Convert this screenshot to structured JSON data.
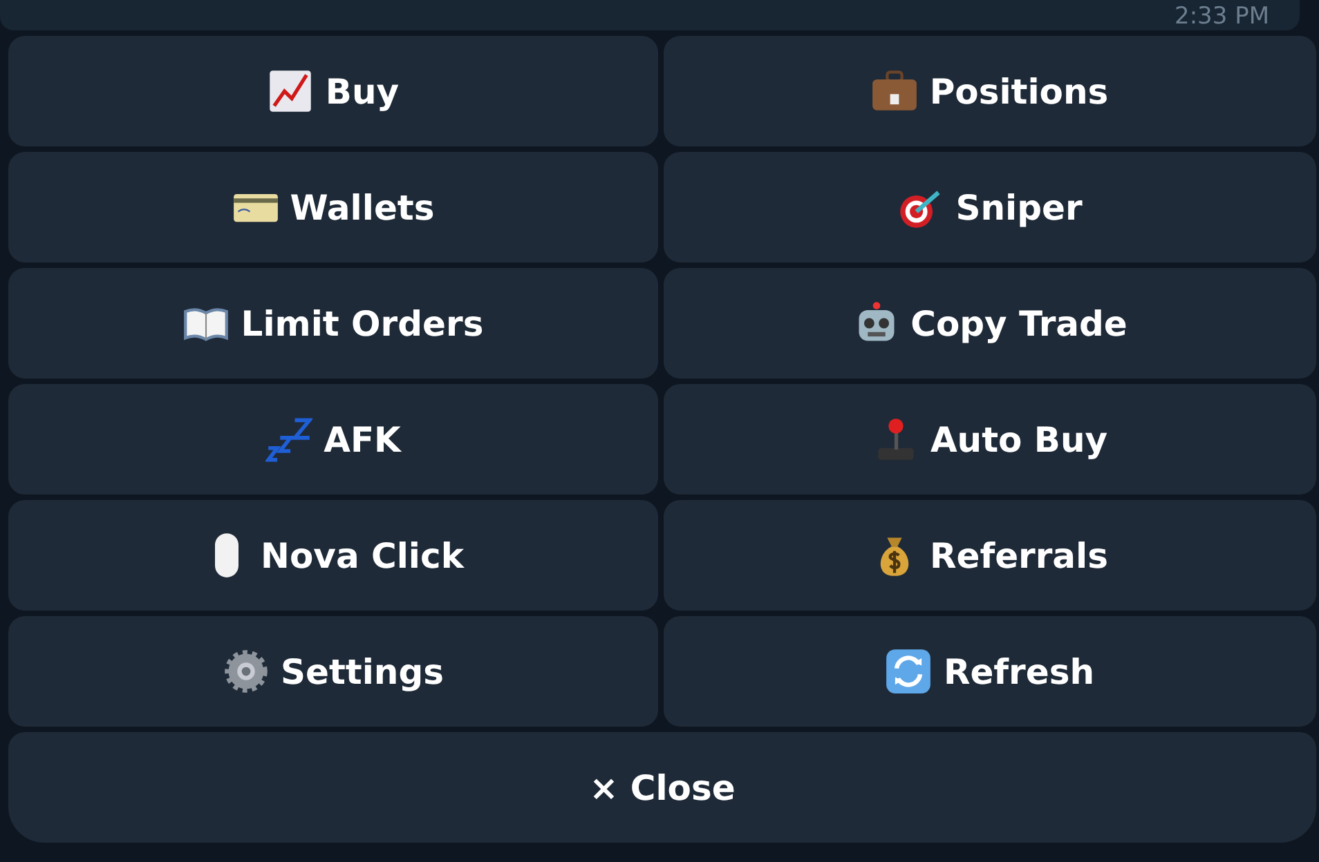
{
  "message": {
    "time": "2:33 PM"
  },
  "keyboard": [
    {
      "label": "Buy"
    },
    {
      "label": "Positions"
    },
    {
      "label": "Wallets"
    },
    {
      "label": "Sniper"
    },
    {
      "label": "Limit Orders"
    },
    {
      "label": "Copy Trade"
    },
    {
      "label": "AFK"
    },
    {
      "label": "Auto Buy"
    },
    {
      "label": "Nova Click"
    },
    {
      "label": "Referrals"
    },
    {
      "label": "Settings"
    },
    {
      "label": "Refresh"
    }
  ],
  "close_button": {
    "label": "× Close"
  }
}
